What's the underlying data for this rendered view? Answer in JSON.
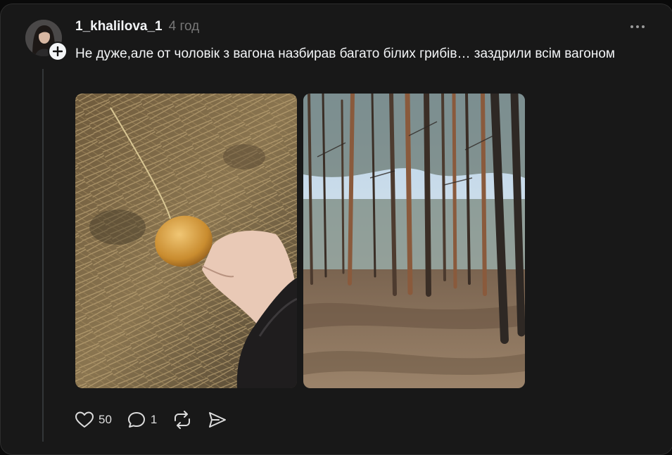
{
  "post": {
    "username": "1_khalilova_1",
    "timestamp": "4 год",
    "text": "Не дуже,але от чоловік з вагона назбирав багато білих грибів… заздрили всім вагоном",
    "images": [
      {
        "icon": "photo-mushroom-in-hand"
      },
      {
        "icon": "photo-pine-forest"
      }
    ]
  },
  "actions": {
    "likes": "50",
    "replies": "1"
  },
  "icons": {
    "like": "heart-icon",
    "reply": "comment-icon",
    "repost": "repost-icon",
    "share": "send-icon",
    "more": "more-dots-icon",
    "follow": "plus-icon"
  },
  "colors": {
    "background": "#0a0a0a",
    "card": "#181818",
    "text": "#f3f5f7",
    "muted": "#777777"
  }
}
